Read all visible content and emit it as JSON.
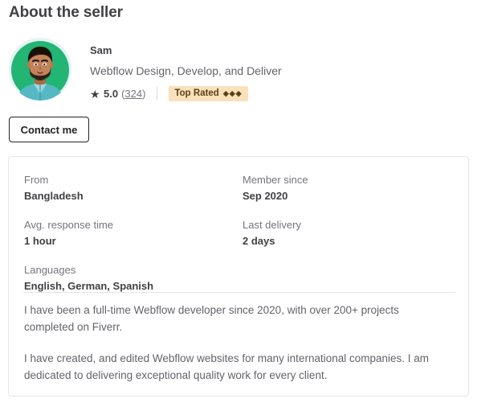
{
  "section": {
    "title": "About the seller"
  },
  "seller": {
    "avatar_alt": "seller-avatar-illustration",
    "name": "Sam",
    "tagline": "Webflow Design, Develop, and Deliver",
    "rating": {
      "star_icon": "star-icon",
      "score": "5.0",
      "count_open": "(",
      "count": "324",
      "count_close": ")"
    },
    "badge": {
      "label": "Top Rated",
      "diamonds": "◆◆◆"
    },
    "contact_button": "Contact me"
  },
  "stats": [
    {
      "label": "From",
      "value": "Bangladesh"
    },
    {
      "label": "Member since",
      "value": "Sep 2020"
    },
    {
      "label": "Avg. response time",
      "value": "1 hour"
    },
    {
      "label": "Last delivery",
      "value": "2 days"
    },
    {
      "label": "Languages",
      "value": "English, German, Spanish"
    }
  ],
  "description": {
    "paragraph_1": "I have been a full-time Webflow developer since 2020, with over 200+ projects completed on Fiverr.",
    "paragraph_2": "I have created, and edited Webflow websites for many international companies. I am dedicated to delivering exceptional quality work for every client."
  },
  "colors": {
    "text_primary": "#404145",
    "text_secondary": "#62646a",
    "text_muted": "#74767e",
    "border": "#e4e5e7",
    "badge_bg": "#fae1bc",
    "badge_text": "#5c4016",
    "avatar_green": "#22b573"
  }
}
